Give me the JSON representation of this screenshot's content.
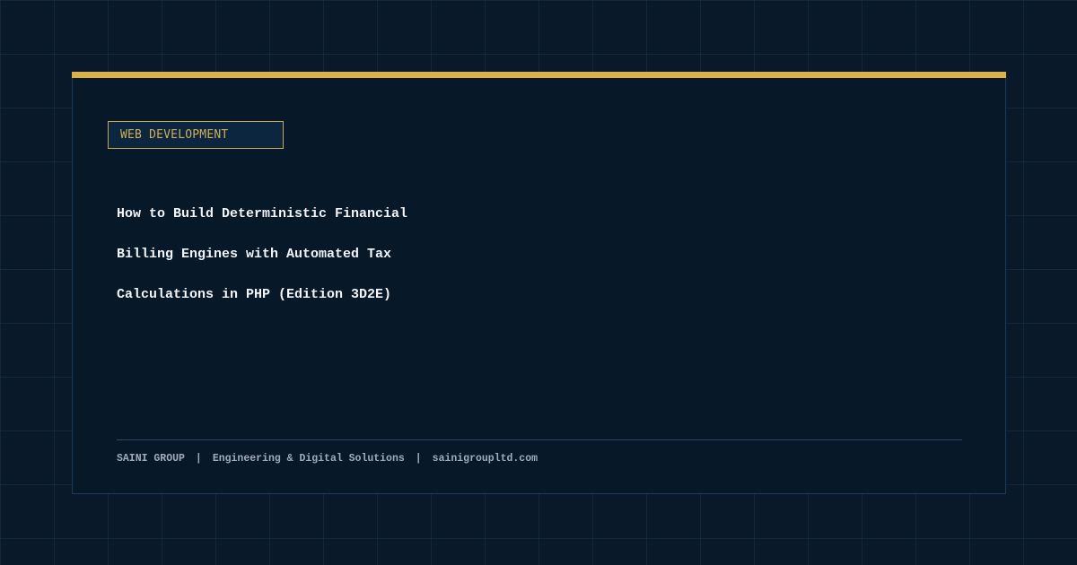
{
  "card": {
    "category": "WEB DEVELOPMENT",
    "title_lines": [
      "How to Build Deterministic Financial",
      "Billing Engines with Automated Tax",
      "Calculations in PHP (Edition 3D2E)"
    ]
  },
  "footer": {
    "company": "SAINI GROUP",
    "separator": "|",
    "tagline": "Engineering & Digital Solutions",
    "website": "sainigroupltd.com"
  },
  "colors": {
    "background": "#0a192a",
    "card": "#071829",
    "accent": "#d8b04c",
    "title_text": "#f2f4f7",
    "footer_text": "#a0acba"
  }
}
